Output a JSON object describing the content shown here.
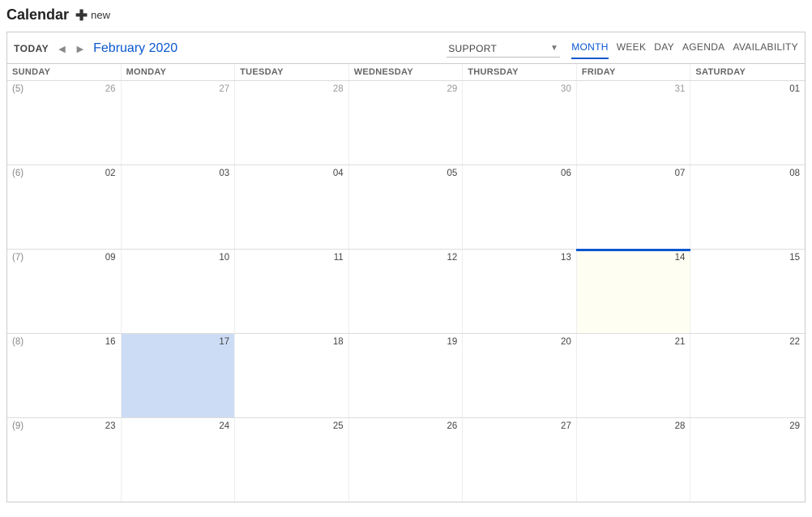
{
  "header": {
    "title": "Calendar",
    "new_label": "new"
  },
  "toolbar": {
    "today_label": "TODAY",
    "month_label": "February 2020",
    "select_value": "SUPPORT",
    "views": {
      "month": "MONTH",
      "week": "WEEK",
      "day": "DAY",
      "agenda": "AGENDA",
      "availability": "AVAILABILITY"
    },
    "active_view": "month"
  },
  "day_headers": [
    "SUNDAY",
    "MONDAY",
    "TUESDAY",
    "WEDNESDAY",
    "THURSDAY",
    "FRIDAY",
    "SATURDAY"
  ],
  "weeks": [
    {
      "weeknum": "(5)",
      "days": [
        {
          "n": "26",
          "other": true
        },
        {
          "n": "27",
          "other": true
        },
        {
          "n": "28",
          "other": true
        },
        {
          "n": "29",
          "other": true
        },
        {
          "n": "30",
          "other": true
        },
        {
          "n": "31",
          "other": true
        },
        {
          "n": "01"
        }
      ]
    },
    {
      "weeknum": "(6)",
      "days": [
        {
          "n": "02"
        },
        {
          "n": "03"
        },
        {
          "n": "04"
        },
        {
          "n": "05"
        },
        {
          "n": "06"
        },
        {
          "n": "07"
        },
        {
          "n": "08"
        }
      ]
    },
    {
      "weeknum": "(7)",
      "days": [
        {
          "n": "09"
        },
        {
          "n": "10"
        },
        {
          "n": "11"
        },
        {
          "n": "12"
        },
        {
          "n": "13"
        },
        {
          "n": "14",
          "today": true
        },
        {
          "n": "15"
        }
      ]
    },
    {
      "weeknum": "(8)",
      "days": [
        {
          "n": "16"
        },
        {
          "n": "17",
          "selected": true
        },
        {
          "n": "18"
        },
        {
          "n": "19"
        },
        {
          "n": "20"
        },
        {
          "n": "21"
        },
        {
          "n": "22"
        }
      ]
    },
    {
      "weeknum": "(9)",
      "days": [
        {
          "n": "23"
        },
        {
          "n": "24"
        },
        {
          "n": "25"
        },
        {
          "n": "26"
        },
        {
          "n": "27"
        },
        {
          "n": "28"
        },
        {
          "n": "29"
        }
      ]
    }
  ]
}
